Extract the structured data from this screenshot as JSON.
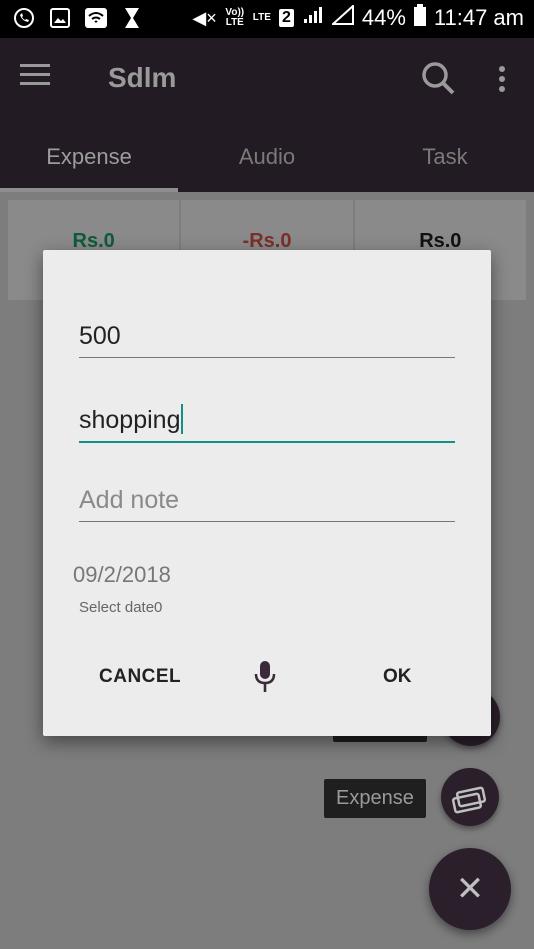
{
  "status_bar": {
    "battery": "44%",
    "time": "11:47 am",
    "volte_label": "Vo)) LTE",
    "lte_label": "LTE",
    "sim_label": "2"
  },
  "app_bar": {
    "title": "Sdlm"
  },
  "tabs": [
    {
      "label": "Expense",
      "active": true
    },
    {
      "label": "Audio",
      "active": false
    },
    {
      "label": "Task",
      "active": false
    }
  ],
  "summary": {
    "income": "Rs.0",
    "expense": "-Rs.0",
    "balance": "Rs.0",
    "colors": {
      "income": "#0f5a3a",
      "expense": "#7a2f2a",
      "balance": "#111111"
    }
  },
  "dialog": {
    "amount_value": "500",
    "category_value": "shopping",
    "note_placeholder": "Add note",
    "date_value": "09/2/2018",
    "date_label": "Select date0",
    "cancel_label": "CANCEL",
    "ok_label": "OK",
    "mic_icon": "mic-icon",
    "accent_color": "#148f83",
    "mic_color": "#3a2a3a"
  },
  "fab": {
    "expense_tag": "Expense",
    "main_icon": "close-icon",
    "expense_icon": "money-icon"
  }
}
